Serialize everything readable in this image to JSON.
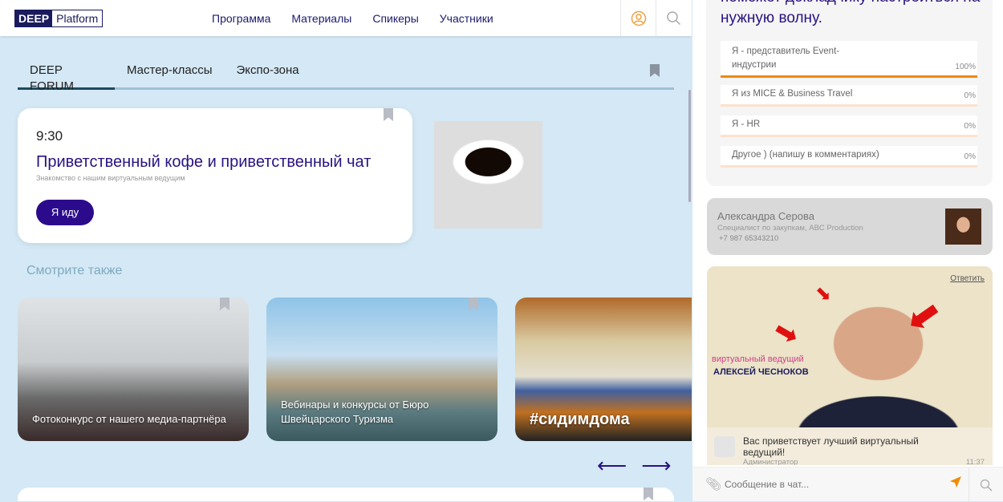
{
  "header": {
    "logo_left": "DEEP",
    "logo_right": "Platform",
    "nav": [
      "Программа",
      "Материалы",
      "Спикеры",
      "Участники"
    ]
  },
  "tabs": [
    "DEEP FORUM",
    "Мастер-классы",
    "Экспо-зона"
  ],
  "event": {
    "time": "9:30",
    "title": "Приветственный кофе и приветственный чат",
    "subtitle": "Знакомство с нашим виртуальным ведущим",
    "button": "Я иду"
  },
  "see_also": {
    "title": "Смотрите также",
    "cards": [
      "Фотоконкурс от нашего медиа-партнёра",
      "Вебинары и конкурсы от Бюро Швейцарского Туризма",
      "#сидимдома"
    ]
  },
  "poll": {
    "title": "поможет докладчику настроиться на нужную волну.",
    "options": [
      {
        "label": "Я - представитель Event-индустрии",
        "percent": "100%"
      },
      {
        "label": "Я из MICE & Business Travel",
        "percent": "0%"
      },
      {
        "label": "Я - HR",
        "percent": "0%"
      },
      {
        "label": "Другое ) (напишу в комментариях)",
        "percent": "0%"
      }
    ],
    "accent": "#f08a00"
  },
  "contact": {
    "name": "Александра Серова",
    "role": "Специалист по закупкам, ABC Production",
    "phone": "+7 987 65343210"
  },
  "chat": {
    "reply": "Ответить",
    "video_caption_1": "виртуальный ведущий",
    "video_caption_2": "АЛЕКСЕЙ ЧЕСНОКОВ",
    "message": "Вас приветствует лучший виртуальный ведущий!",
    "author": "Администратор",
    "time": "11:37",
    "placeholder": "Сообщение в чат..."
  }
}
